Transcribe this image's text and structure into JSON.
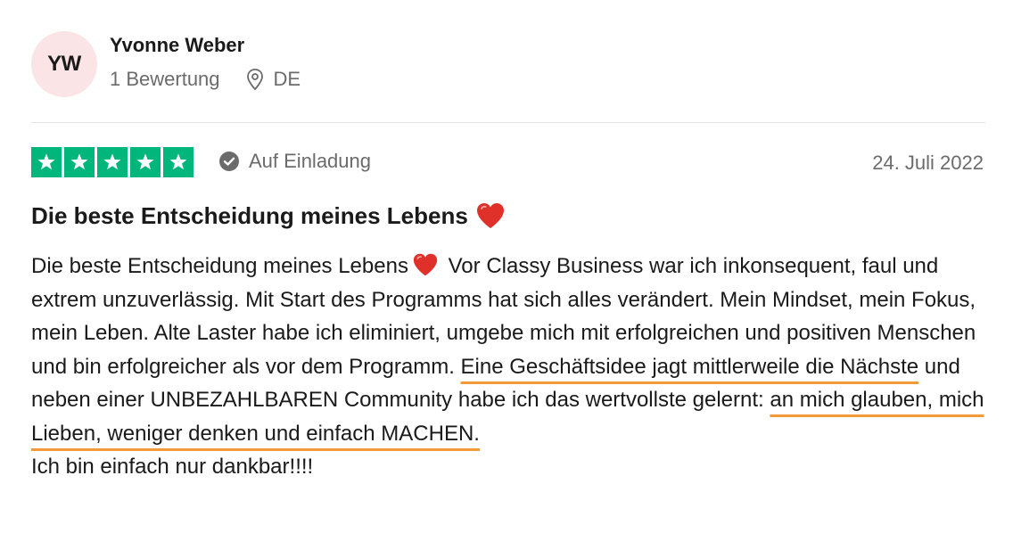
{
  "reviewer": {
    "initials": "YW",
    "name": "Yvonne Weber",
    "review_count": "1 Bewertung",
    "country": "DE"
  },
  "review": {
    "rating": 5,
    "max_rating": 5,
    "star_color": "#00b67a",
    "verification_label": "Auf Einladung",
    "date": "24. Juli 2022",
    "title": "Die beste Entscheidung meines Lebens",
    "body": {
      "p1_a": "Die beste Entscheidung meines Lebens",
      "p1_b": " Vor Classy Business war ich inkonsequent, faul und extrem unzuverlässig. Mit Start des Programms hat sich alles verändert. Mein Mindset, mein Fokus, mein Leben. Alte Laster habe ich eliminiert, umgebe mich mit erfolgreichen und positiven Menschen und bin erfolgreicher als vor dem Programm. ",
      "highlight_1": "Eine Geschäftsidee jagt mittlerweile die Nächste",
      "p1_c": " und neben einer UNBEZAHLBAREN Community habe ich das wertvollste gelernt: ",
      "highlight_2": "an mich glauben, mich Lieben, weniger denken und einfach MACHEN.",
      "p2": "Ich bin einfach nur dankbar!!!!"
    },
    "highlight_color": "#f29a38"
  }
}
